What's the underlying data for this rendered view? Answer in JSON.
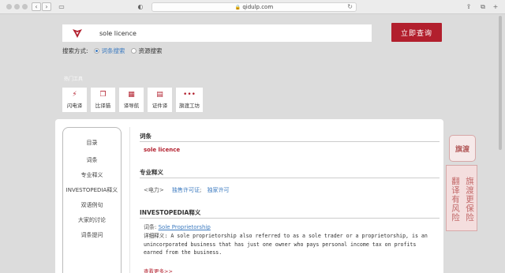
{
  "browser": {
    "url": "qidulp.com",
    "back_symbol": "‹",
    "forward_symbol": "›",
    "reload_symbol": "↻",
    "lock_symbol": "🔒",
    "icons": [
      "sidebar-icon",
      "shield-icon",
      "share-icon",
      "tabs-icon",
      "add-tab-icon"
    ]
  },
  "search": {
    "query": "sole licence",
    "button_label": "立即查询",
    "mode_label": "搜索方式:",
    "modes": [
      {
        "label": "词条搜索",
        "selected": true
      },
      {
        "label": "资源搜索",
        "selected": false
      }
    ]
  },
  "tools": {
    "heading": "热门工具",
    "items": [
      {
        "label": "闪电译",
        "icon": "⚡"
      },
      {
        "label": "比译猫",
        "icon": "❐"
      },
      {
        "label": "译导航",
        "icon": "▦"
      },
      {
        "label": "证件译",
        "icon": "▤"
      },
      {
        "label": "旗渡工坊",
        "icon": "•••"
      }
    ]
  },
  "toc": {
    "title": "目录",
    "items": [
      "词条",
      "专业释义",
      "INVESTOPEDIA释义",
      "双语例句",
      "大家的讨论",
      "词条提问"
    ]
  },
  "content": {
    "entry_heading": "词条",
    "entry_term": "sole licence",
    "pro_heading": "专业释义",
    "pro_domain": "<电力>",
    "pro_translations": [
      "独售许可证",
      "独家许可"
    ],
    "investopedia_heading": "INVESTOPEDIA释义",
    "inv_word_label": "词条:",
    "inv_word": "Sole Proprietorship",
    "inv_detail": "详细释义: A sole proprietorship also referred to as a sole trader or a proprietorship, is an unincorporated business that has just one owner who pays personal income tax on profits earned from the business.",
    "more_link": "查看更多>>"
  },
  "banner": {
    "logo_text": "旗渡",
    "column_1": "翻译有风险",
    "column_2": "旗渡更保险"
  }
}
